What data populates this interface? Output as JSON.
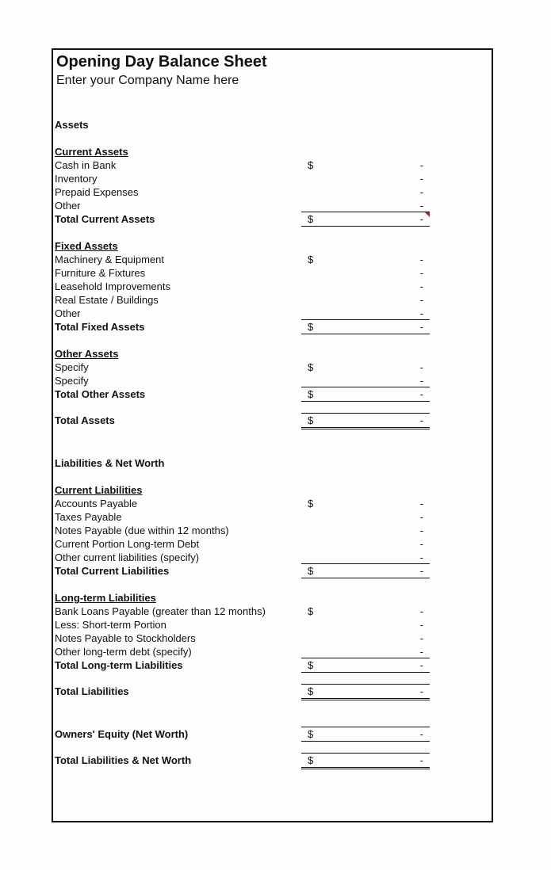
{
  "header": {
    "title": "Opening Day Balance Sheet",
    "company": "Enter your Company Name here"
  },
  "currency_symbol": "$",
  "empty_value": "-",
  "sections": {
    "assets_label": "Assets",
    "liabilities_label": "Liabilities & Net Worth"
  },
  "current_assets": {
    "heading": "Current Assets",
    "items": [
      "Cash in Bank",
      "Inventory",
      "Prepaid Expenses",
      "Other"
    ],
    "total": "Total Current Assets"
  },
  "fixed_assets": {
    "heading": "Fixed Assets",
    "items": [
      "Machinery & Equipment",
      "Furniture & Fixtures",
      "Leasehold Improvements",
      "Real Estate / Buildings",
      "Other"
    ],
    "total": "Total Fixed Assets"
  },
  "other_assets": {
    "heading": "Other Assets",
    "items": [
      "Specify",
      "Specify"
    ],
    "total": "Total Other Assets"
  },
  "total_assets": "Total Assets",
  "current_liabilities": {
    "heading": "Current Liabilities",
    "items": [
      "Accounts Payable",
      "Taxes Payable",
      "Notes Payable (due within 12 months)",
      "Current Portion Long-term Debt",
      "Other current liabilities (specify)"
    ],
    "total": "Total Current Liabilities"
  },
  "longterm_liabilities": {
    "heading": "Long-term Liabilities",
    "items": [
      "Bank Loans Payable (greater than 12 months)",
      "Less: Short-term Portion",
      "Notes Payable to Stockholders",
      "Other long-term debt (specify)"
    ],
    "total": "Total Long-term Liabilities"
  },
  "total_liabilities": "Total Liabilities",
  "owners_equity": "Owners' Equity (Net Worth)",
  "total_liabilities_net_worth": "Total Liabilities & Net Worth"
}
